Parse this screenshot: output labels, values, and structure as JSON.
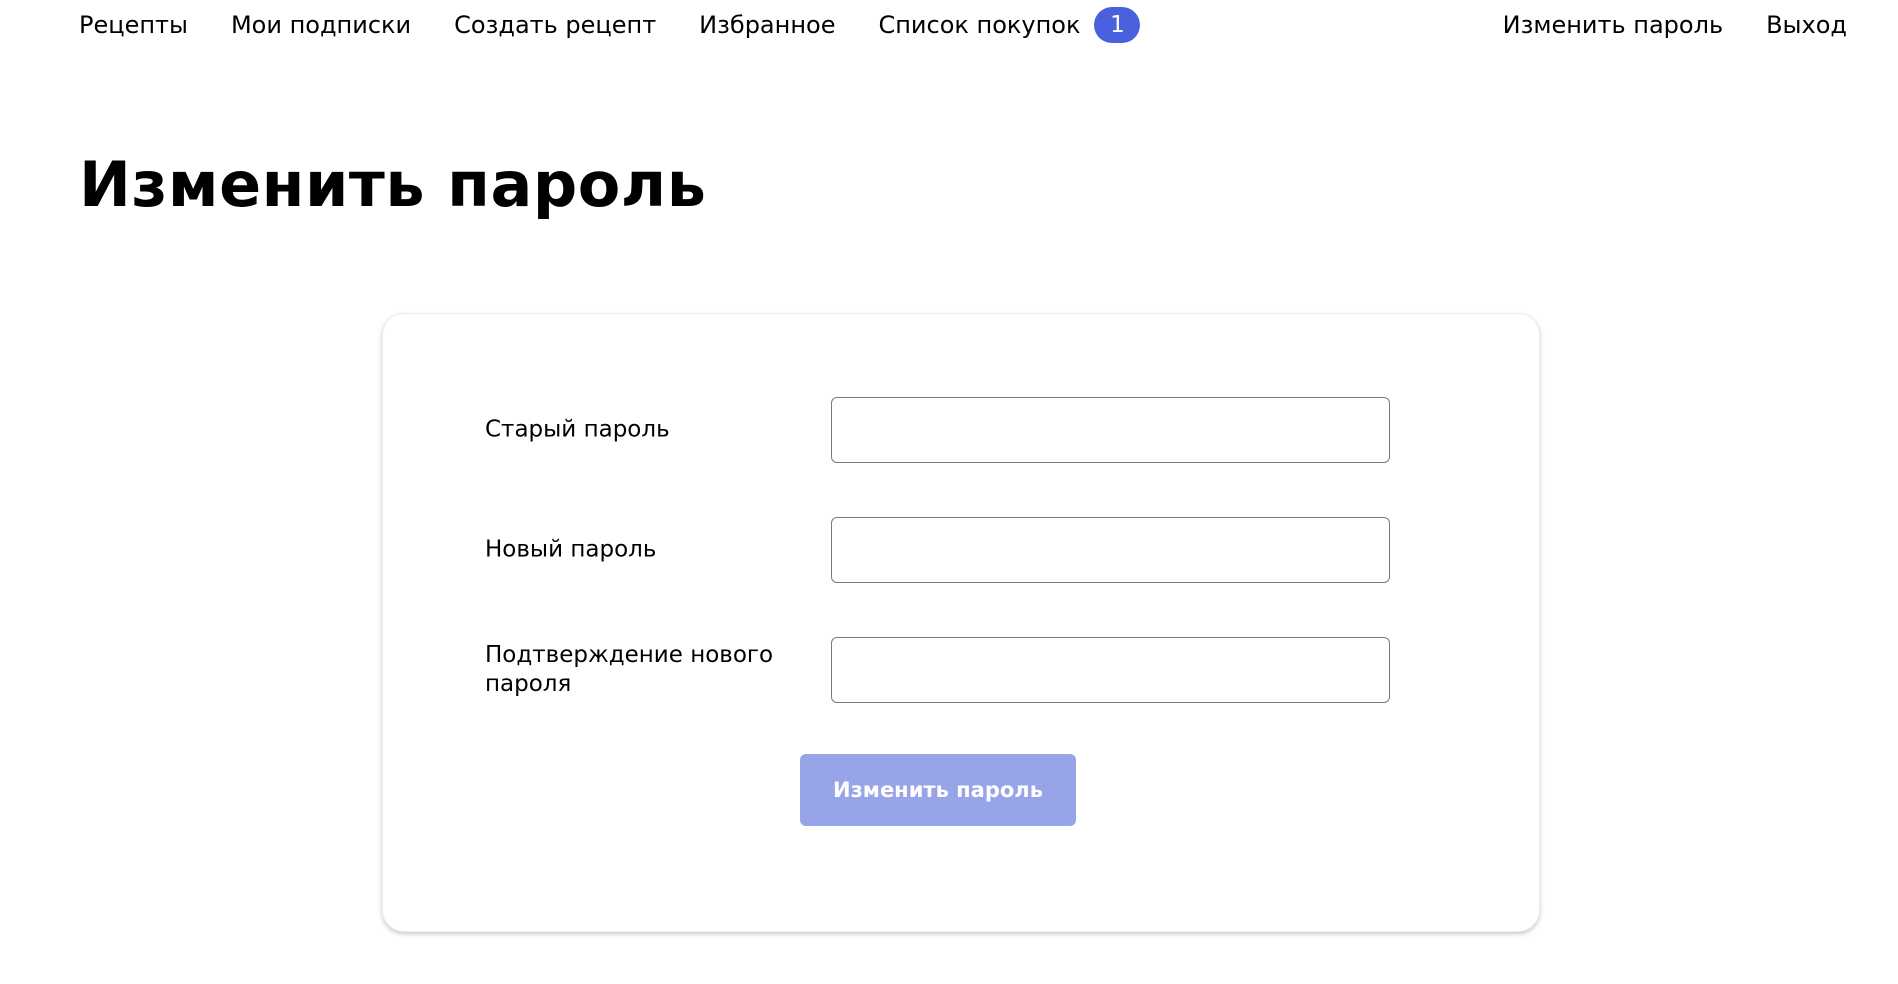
{
  "nav": {
    "left": [
      {
        "label": "Рецепты"
      },
      {
        "label": "Мои подписки"
      },
      {
        "label": "Создать рецепт"
      },
      {
        "label": "Избранное"
      },
      {
        "label": "Список покупок"
      }
    ],
    "cart_count": "1",
    "right": [
      {
        "label": "Изменить пароль"
      },
      {
        "label": "Выход"
      }
    ]
  },
  "page": {
    "title": "Изменить пароль"
  },
  "form": {
    "fields": [
      {
        "label": "Старый пароль",
        "value": ""
      },
      {
        "label": "Новый пароль",
        "value": ""
      },
      {
        "label": "Подтверждение нового пароля",
        "value": ""
      }
    ],
    "submit_label": "Изменить пароль"
  },
  "colors": {
    "accent": "#4a61dd",
    "button_disabled": "#97a4e8"
  }
}
